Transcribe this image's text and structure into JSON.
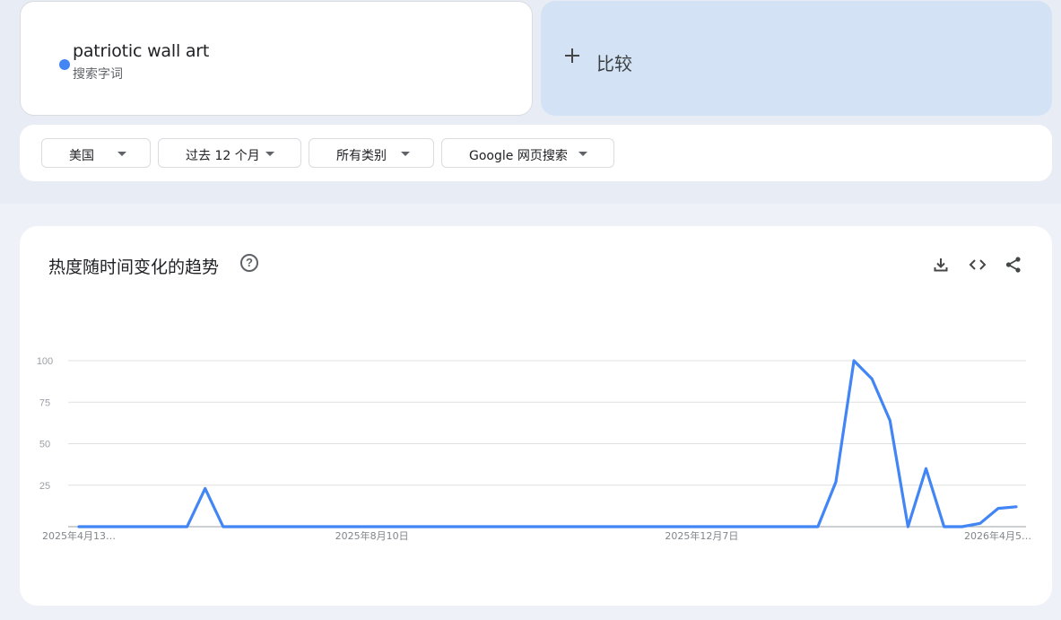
{
  "search_term": {
    "name": "patriotic wall art",
    "type_label": "搜索字词",
    "color": "#4285f4"
  },
  "compare": {
    "label": "比较"
  },
  "filters": [
    {
      "label": "美国"
    },
    {
      "label": "过去 12 个月"
    },
    {
      "label": "所有类别"
    },
    {
      "label": "Google 网页搜索"
    }
  ],
  "panel": {
    "title": "热度随时间变化的趋势",
    "help_icon": "help-circle-icon",
    "tools": [
      "download-icon",
      "embed-code-icon",
      "share-icon"
    ]
  },
  "chart_data": {
    "type": "line",
    "title": "热度随时间变化的趋势",
    "xlabel": "",
    "ylabel": "",
    "ylim": [
      0,
      100
    ],
    "yticks": [
      25,
      50,
      75,
      100
    ],
    "x_tick_labels": [
      "2025年4月13…",
      "2025年8月10日",
      "2025年12月7日",
      "2026年4月5…"
    ],
    "grid": true,
    "series": [
      {
        "name": "patriotic wall art",
        "color": "#4285f4",
        "values": [
          0,
          0,
          0,
          0,
          0,
          0,
          0,
          23,
          0,
          0,
          0,
          0,
          0,
          0,
          0,
          0,
          0,
          0,
          0,
          0,
          0,
          0,
          0,
          0,
          0,
          0,
          0,
          0,
          0,
          0,
          0,
          0,
          0,
          0,
          0,
          0,
          0,
          0,
          0,
          0,
          0,
          0,
          27,
          100,
          89,
          64,
          0,
          35,
          0,
          0,
          2,
          11,
          12
        ]
      }
    ]
  }
}
